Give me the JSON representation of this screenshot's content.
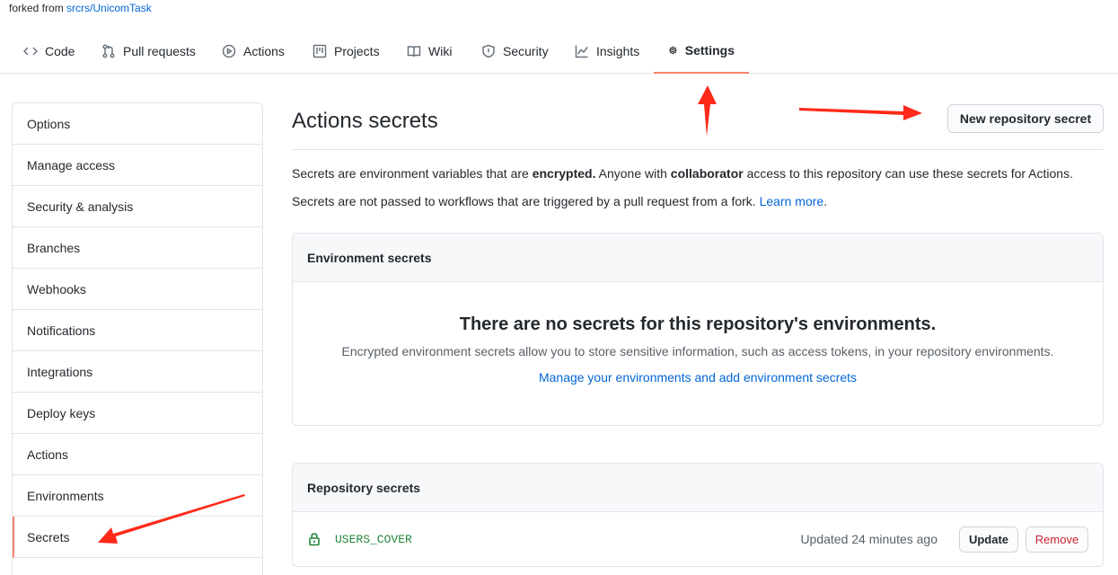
{
  "fork": {
    "prefix": "forked from",
    "source": "srcrs/UnicomTask"
  },
  "nav": {
    "tabs": [
      {
        "label": "Code",
        "icon": "code-icon"
      },
      {
        "label": "Pull requests",
        "icon": "pull-request-icon"
      },
      {
        "label": "Actions",
        "icon": "play-icon"
      },
      {
        "label": "Projects",
        "icon": "project-icon"
      },
      {
        "label": "Wiki",
        "icon": "book-icon"
      },
      {
        "label": "Security",
        "icon": "shield-icon"
      },
      {
        "label": "Insights",
        "icon": "graph-icon"
      },
      {
        "label": "Settings",
        "icon": "gear-icon",
        "active": true
      }
    ]
  },
  "sidebar": {
    "items": [
      {
        "label": "Options"
      },
      {
        "label": "Manage access"
      },
      {
        "label": "Security & analysis"
      },
      {
        "label": "Branches"
      },
      {
        "label": "Webhooks"
      },
      {
        "label": "Notifications"
      },
      {
        "label": "Integrations"
      },
      {
        "label": "Deploy keys"
      },
      {
        "label": "Actions"
      },
      {
        "label": "Environments"
      },
      {
        "label": "Secrets",
        "selected": true
      }
    ]
  },
  "main": {
    "title": "Actions secrets",
    "new_secret_label": "New repository secret",
    "desc1": {
      "a": "Secrets are environment variables that are ",
      "b": "encrypted.",
      "c": " Anyone with ",
      "d": "collaborator",
      "e": " access to this repository can use these secrets for Actions."
    },
    "desc2": {
      "text": "Secrets are not passed to workflows that are triggered by a pull request from a fork. ",
      "link": "Learn more",
      "end": "."
    },
    "env_box": {
      "header": "Environment secrets",
      "blank_title": "There are no secrets for this repository's environments.",
      "blank_text": "Encrypted environment secrets allow you to store sensitive information, such as access tokens, in your repository environments.",
      "manage_link": "Manage your environments and add environment secrets"
    },
    "repo_box": {
      "header": "Repository secrets",
      "secrets": [
        {
          "name": "USERS_COVER",
          "updated": "Updated 24 minutes ago",
          "update_label": "Update",
          "remove_label": "Remove"
        }
      ]
    }
  },
  "colors": {
    "accent_underline": "#f9826c",
    "link": "#0366d6",
    "danger": "#cb2431",
    "arrow": "#ff2a1a"
  }
}
